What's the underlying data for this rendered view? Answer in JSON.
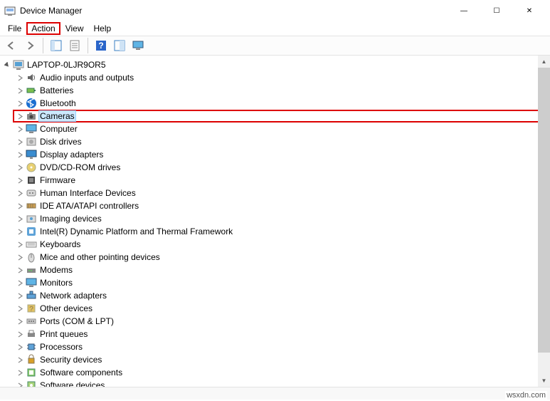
{
  "window": {
    "title": "Device Manager",
    "controls": {
      "minimize": "—",
      "maximize": "☐",
      "close": "✕"
    }
  },
  "menu": {
    "file": "File",
    "action": "Action",
    "view": "View",
    "help": "Help"
  },
  "toolbar": {
    "back": "back",
    "forward": "forward",
    "show_hide": "show-hide-console-tree",
    "properties": "properties",
    "help": "help",
    "scan": "scan-hardware",
    "monitor": "monitor"
  },
  "tree": {
    "root": "LAPTOP-0LJR9OR5",
    "items": [
      {
        "label": "Audio inputs and outputs",
        "icon": "audio"
      },
      {
        "label": "Batteries",
        "icon": "battery"
      },
      {
        "label": "Bluetooth",
        "icon": "bluetooth"
      },
      {
        "label": "Cameras",
        "icon": "camera",
        "selected": true,
        "boxed": true
      },
      {
        "label": "Computer",
        "icon": "computer"
      },
      {
        "label": "Disk drives",
        "icon": "disk"
      },
      {
        "label": "Display adapters",
        "icon": "display"
      },
      {
        "label": "DVD/CD-ROM drives",
        "icon": "dvd"
      },
      {
        "label": "Firmware",
        "icon": "firmware"
      },
      {
        "label": "Human Interface Devices",
        "icon": "hid"
      },
      {
        "label": "IDE ATA/ATAPI controllers",
        "icon": "ide"
      },
      {
        "label": "Imaging devices",
        "icon": "imaging"
      },
      {
        "label": "Intel(R) Dynamic Platform and Thermal Framework",
        "icon": "intel"
      },
      {
        "label": "Keyboards",
        "icon": "keyboard"
      },
      {
        "label": "Mice and other pointing devices",
        "icon": "mouse"
      },
      {
        "label": "Modems",
        "icon": "modem"
      },
      {
        "label": "Monitors",
        "icon": "monitor"
      },
      {
        "label": "Network adapters",
        "icon": "network"
      },
      {
        "label": "Other devices",
        "icon": "other"
      },
      {
        "label": "Ports (COM & LPT)",
        "icon": "ports"
      },
      {
        "label": "Print queues",
        "icon": "print"
      },
      {
        "label": "Processors",
        "icon": "cpu"
      },
      {
        "label": "Security devices",
        "icon": "security"
      },
      {
        "label": "Software components",
        "icon": "software"
      },
      {
        "label": "Software devices",
        "icon": "softdev"
      }
    ]
  },
  "watermark": "wsxdn.com"
}
